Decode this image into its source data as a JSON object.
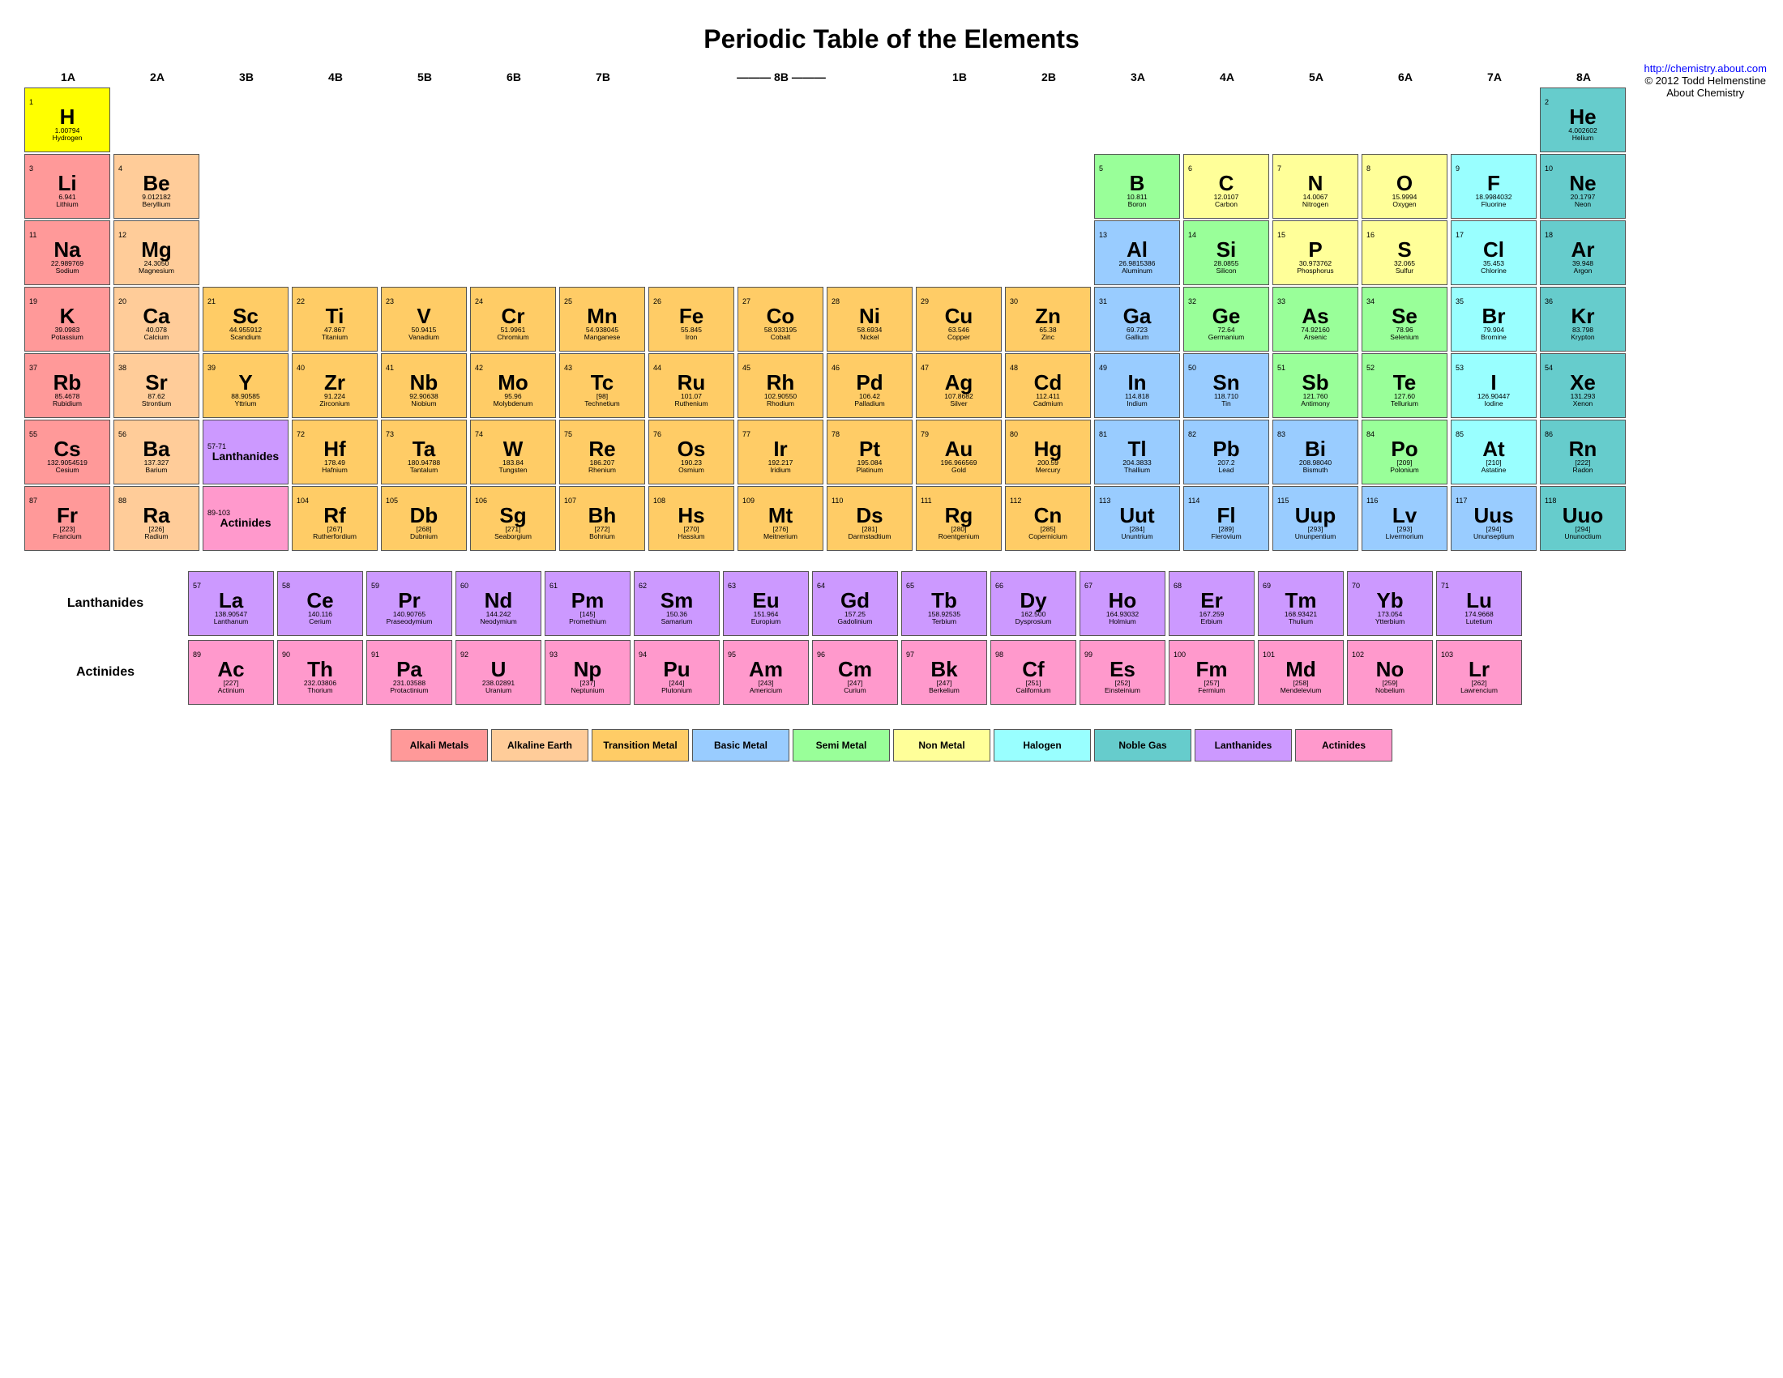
{
  "title": "Periodic Table of the Elements",
  "info": {
    "url": "http://chemistry.about.com",
    "copyright": "© 2012 Todd Helmenstine",
    "subtitle": "About Chemistry"
  },
  "group_labels": [
    "1A",
    "2A",
    "3B",
    "4B",
    "5B",
    "6B",
    "7B",
    "8B",
    "8B",
    "8B",
    "1B",
    "2B",
    "3A",
    "4A",
    "5A",
    "6A",
    "7A",
    "8A"
  ],
  "legend": [
    {
      "label": "Alkali Metals",
      "color": "#ff9999"
    },
    {
      "label": "Alkaline Earth",
      "color": "#ffcc99"
    },
    {
      "label": "Transition Metal",
      "color": "#ffcc66"
    },
    {
      "label": "Basic Metal",
      "color": "#99ccff"
    },
    {
      "label": "Semi Metal",
      "color": "#99ff99"
    },
    {
      "label": "Non Metal",
      "color": "#ffff99"
    },
    {
      "label": "Halogen",
      "color": "#99ffff"
    },
    {
      "label": "Noble Gas",
      "color": "#66cccc"
    },
    {
      "label": "Lanthanides",
      "color": "#cc99ff"
    },
    {
      "label": "Actinides",
      "color": "#ff99cc"
    }
  ]
}
